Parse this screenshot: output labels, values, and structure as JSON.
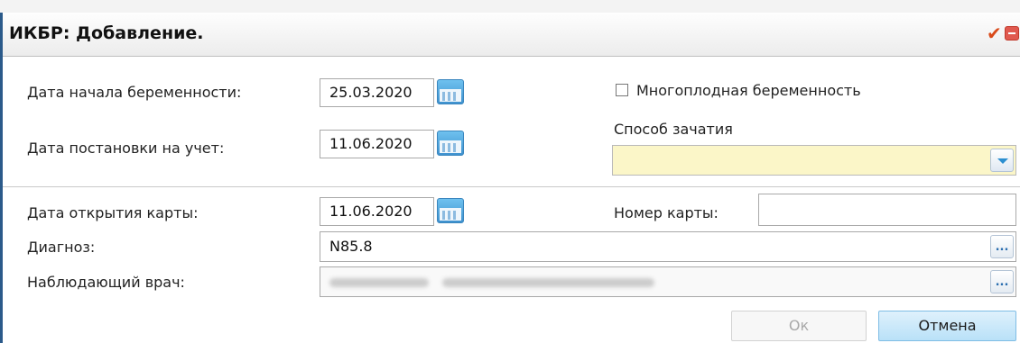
{
  "window": {
    "title": "ИКБР: Добавление.",
    "controls": [
      "check-icon",
      "minimize-icon",
      "close-icon"
    ]
  },
  "form": {
    "pregnancy_start_label": "Дата начала беременности:",
    "pregnancy_start_value": "25.03.2020",
    "registration_date_label": "Дата постановки на учет:",
    "registration_date_value": "11.06.2020",
    "multiple_pregnancy_label": "Многоплодная беременность",
    "multiple_pregnancy_checked": false,
    "conception_method_label": "Способ зачатия",
    "conception_method_value": "",
    "card_open_date_label": "Дата открытия карты:",
    "card_open_date_value": "11.06.2020",
    "card_number_label": "Номер карты:",
    "card_number_value": "",
    "diagnosis_label": "Диагноз:",
    "diagnosis_value": "N85.8",
    "doctor_label": "Наблюдающий врач:",
    "lookup_button_text": "..."
  },
  "buttons": {
    "ok": "Ок",
    "cancel": "Отмена"
  },
  "colors": {
    "select_background": "#fbf6c8",
    "cancel_button": "#b9e1f8",
    "title_check": "#d94a1a",
    "title_buttons": "#e0594f"
  }
}
